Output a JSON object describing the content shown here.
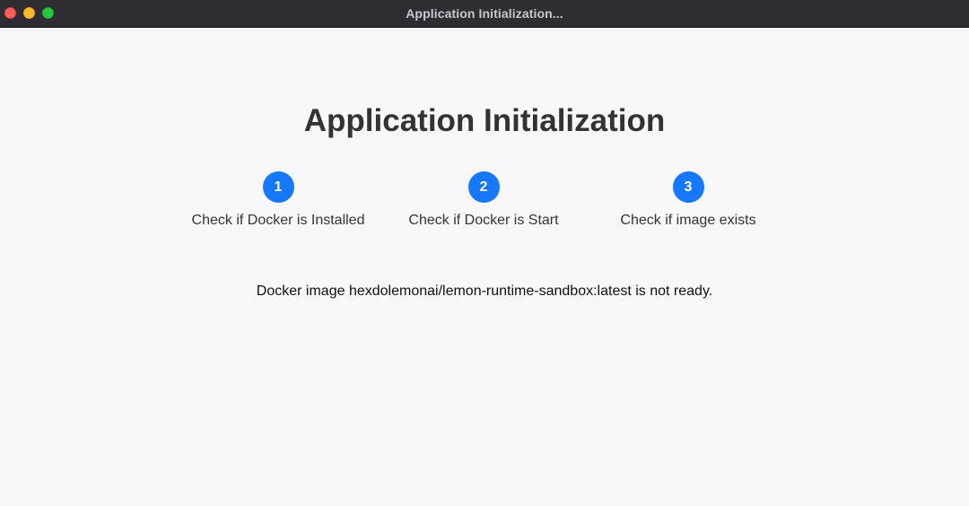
{
  "window": {
    "title": "Application Initialization..."
  },
  "main": {
    "heading": "Application Initialization",
    "steps": [
      {
        "number": "1",
        "label": "Check if Docker is Installed"
      },
      {
        "number": "2",
        "label": "Check if Docker is Start"
      },
      {
        "number": "3",
        "label": "Check if image exists"
      }
    ],
    "status_message": "Docker image hexdolemonai/lemon-runtime-sandbox:latest is not ready."
  },
  "colors": {
    "step_accent": "#1677ff",
    "titlebar": "#2f2c34",
    "background": "#f8f8fa"
  }
}
